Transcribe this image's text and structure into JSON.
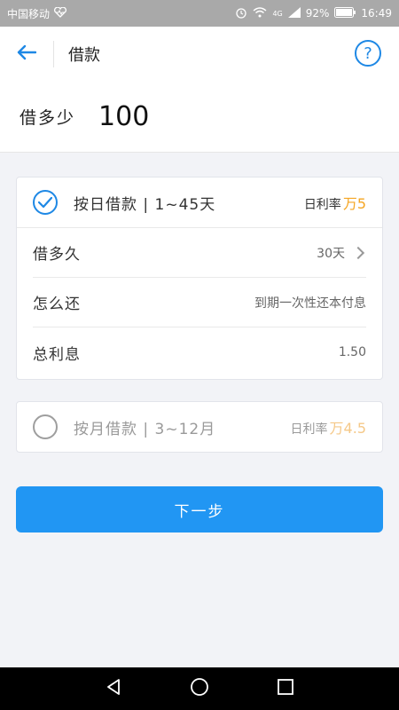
{
  "status": {
    "carrier": "中国移动",
    "network": "4G",
    "battery": "92%",
    "time": "16:49"
  },
  "header": {
    "title": "借款",
    "help_symbol": "?"
  },
  "amount": {
    "label": "借多少",
    "value": "100"
  },
  "plan_daily": {
    "name": "按日借款 | 1~45天",
    "rate_label": "日利率",
    "rate_value": "万5",
    "selected": true,
    "items": [
      {
        "label": "借多久",
        "value": "30天"
      },
      {
        "label": "怎么还",
        "value": "到期一次性还本付息"
      },
      {
        "label": "总利息",
        "value": "1.50"
      }
    ]
  },
  "plan_monthly": {
    "name": "按月借款 | 3~12月",
    "rate_label": "日利率",
    "rate_value": "万4.5",
    "selected": false
  },
  "next_button": {
    "label": "下一步"
  },
  "colors": {
    "accent": "#2196f3",
    "rate": "#f5a623"
  }
}
